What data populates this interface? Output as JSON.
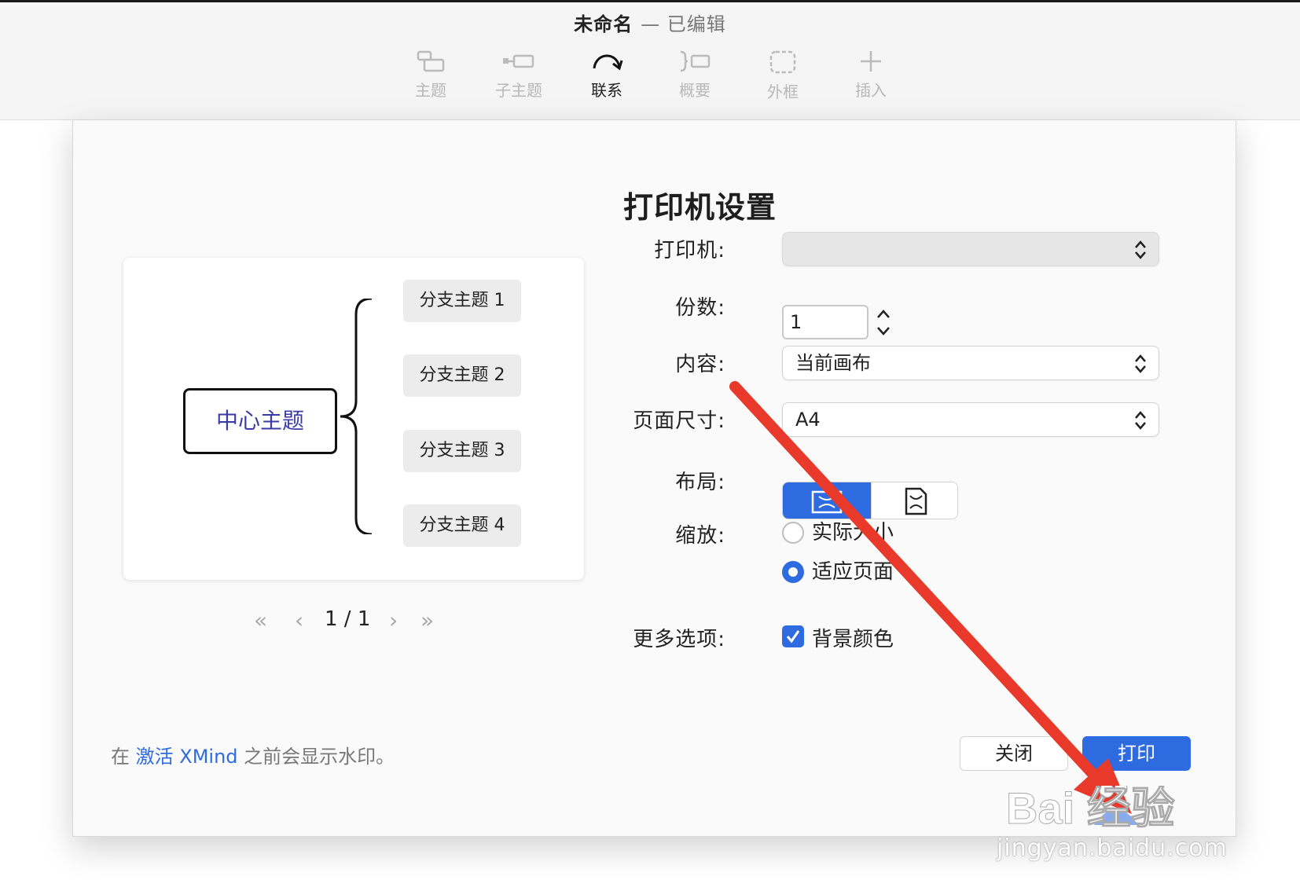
{
  "window": {
    "title": "未命名",
    "status": "— 已编辑"
  },
  "toolbar": {
    "items": [
      {
        "label": "主题",
        "icon": "topic-icon",
        "active": false
      },
      {
        "label": "子主题",
        "icon": "subtopic-icon",
        "active": false
      },
      {
        "label": "联系",
        "icon": "relationship-icon",
        "active": true
      },
      {
        "label": "概要",
        "icon": "summary-icon",
        "active": false
      },
      {
        "label": "外框",
        "icon": "boundary-icon",
        "active": false
      },
      {
        "label": "插入",
        "icon": "plus-icon",
        "active": false
      }
    ]
  },
  "dialog": {
    "title": "打印机设置",
    "preview": {
      "central_topic": "中心主题",
      "branches": [
        "分支主题 1",
        "分支主题 2",
        "分支主题 3",
        "分支主题 4"
      ],
      "pager": {
        "first": "«",
        "prev": "‹",
        "page": "1 / 1",
        "next": "›",
        "last": "»"
      }
    },
    "form": {
      "printer_label": "打印机:",
      "printer_value": "",
      "copies_label": "份数:",
      "copies_value": "1",
      "content_label": "内容:",
      "content_value": "当前画布",
      "page_size_label": "页面尺寸:",
      "page_size_value": "A4",
      "layout_label": "布局:",
      "scale_label": "缩放:",
      "scale_options": [
        "实际大小",
        "适应页面"
      ],
      "scale_selected": "适应页面",
      "more_label": "更多选项:",
      "background_color_label": "背景颜色",
      "background_color_checked": true
    },
    "watermark_note": {
      "prefix": "在",
      "link": "激活 XMind",
      "suffix": "之前会显示水印。"
    },
    "buttons": {
      "close": "关闭",
      "print": "打印"
    }
  },
  "watermark": {
    "brand": "Bai 经验",
    "url": "jingyan.baidu.com"
  },
  "colors": {
    "accent": "#2f6be0",
    "annotation_arrow": "#e8392a"
  }
}
